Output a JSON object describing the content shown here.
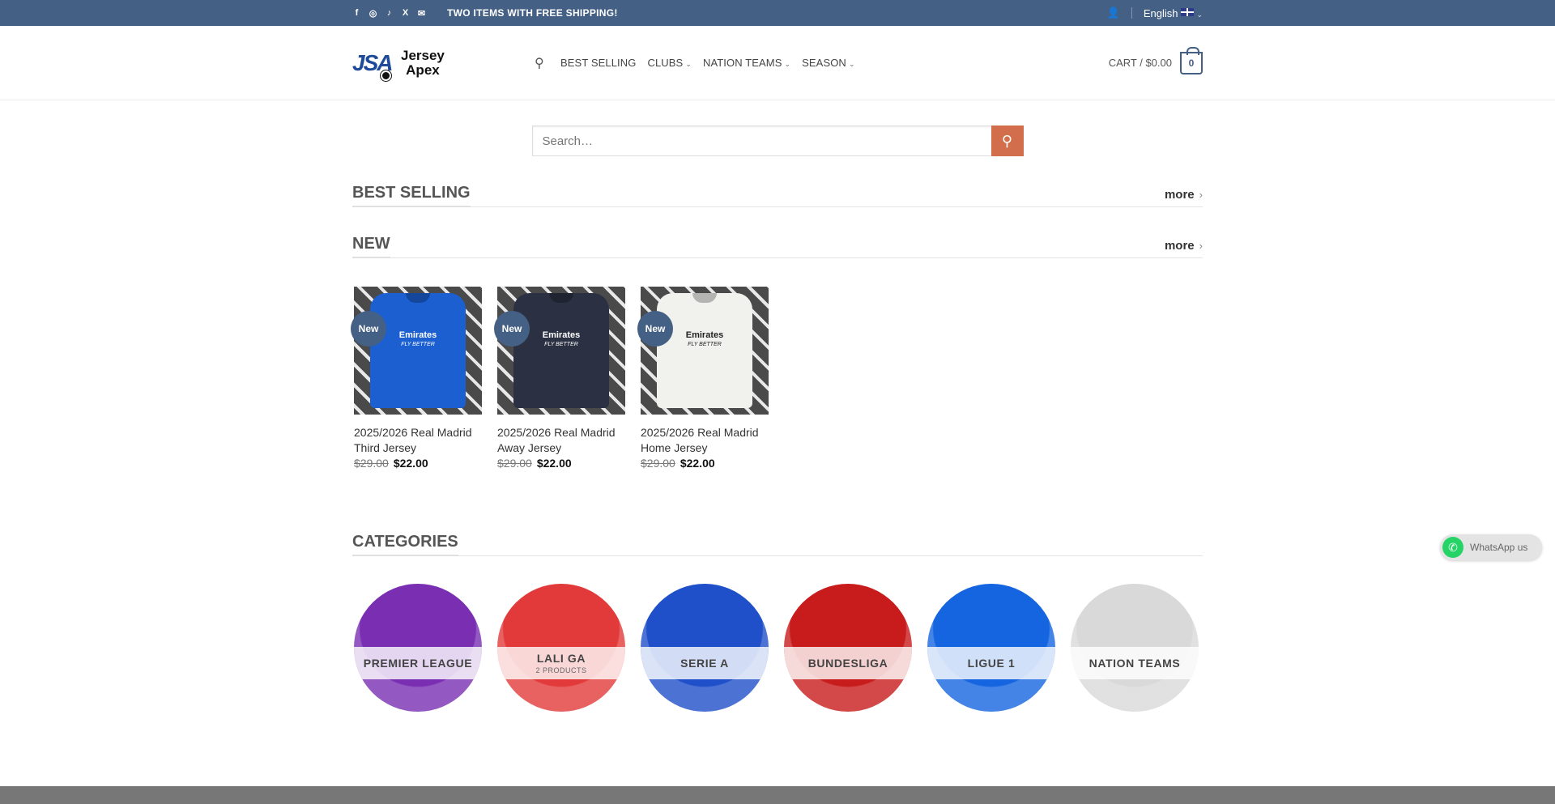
{
  "topbar": {
    "social_icons": [
      "facebook-icon",
      "instagram-icon",
      "tiktok-icon",
      "x-icon",
      "email-icon"
    ],
    "social_glyphs": [
      "f",
      "◎",
      "♪",
      "X",
      "✉"
    ],
    "promo": "TWO ITEMS WITH FREE SHIPPING!",
    "account_icon": "user-icon",
    "language": "English"
  },
  "header": {
    "logo_mark": "JSA",
    "logo_name_1": "Jersey",
    "logo_name_2": "Apex",
    "nav": [
      {
        "label": "BEST SELLING",
        "dropdown": false
      },
      {
        "label": "CLUBS",
        "dropdown": true
      },
      {
        "label": "NATION TEAMS",
        "dropdown": true
      },
      {
        "label": "SEASON",
        "dropdown": true
      }
    ],
    "cart_label": "CART / $0.00",
    "cart_count": "0"
  },
  "search": {
    "placeholder": "Search…"
  },
  "sections": {
    "best_selling": {
      "title": "BEST SELLING",
      "more": "more"
    },
    "new": {
      "title": "NEW",
      "more": "more"
    },
    "categories": {
      "title": "CATEGORIES"
    }
  },
  "products": [
    {
      "badge": "New",
      "name": "2025/2026 Real Madrid Third Jersey",
      "old_price": "$29.00",
      "price": "$22.00",
      "color": "#1b5fd1"
    },
    {
      "badge": "New",
      "name": "2025/2026 Real Madrid Away Jersey",
      "old_price": "$29.00",
      "price": "$22.00",
      "color": "#2b3142"
    },
    {
      "badge": "New",
      "name": "2025/2026 Real Madrid Home Jersey",
      "old_price": "$29.00",
      "price": "$22.00",
      "color": "#f1f1ee"
    }
  ],
  "categories": [
    {
      "name": "PREMIER LEAGUE",
      "count": "",
      "color": "#7a2fb3"
    },
    {
      "name": "LALI GA",
      "count": "2 PRODUCTS",
      "color": "#e23a3a"
    },
    {
      "name": "SERIE A",
      "count": "",
      "color": "#1f4fc9"
    },
    {
      "name": "BUNDESLIGA",
      "count": "",
      "color": "#c81b1b"
    },
    {
      "name": "LIGUE 1",
      "count": "",
      "color": "#1565e0"
    },
    {
      "name": "NATION TEAMS",
      "count": "",
      "color": "#d9d9d9"
    }
  ],
  "whatsapp": {
    "label": "WhatsApp us"
  }
}
